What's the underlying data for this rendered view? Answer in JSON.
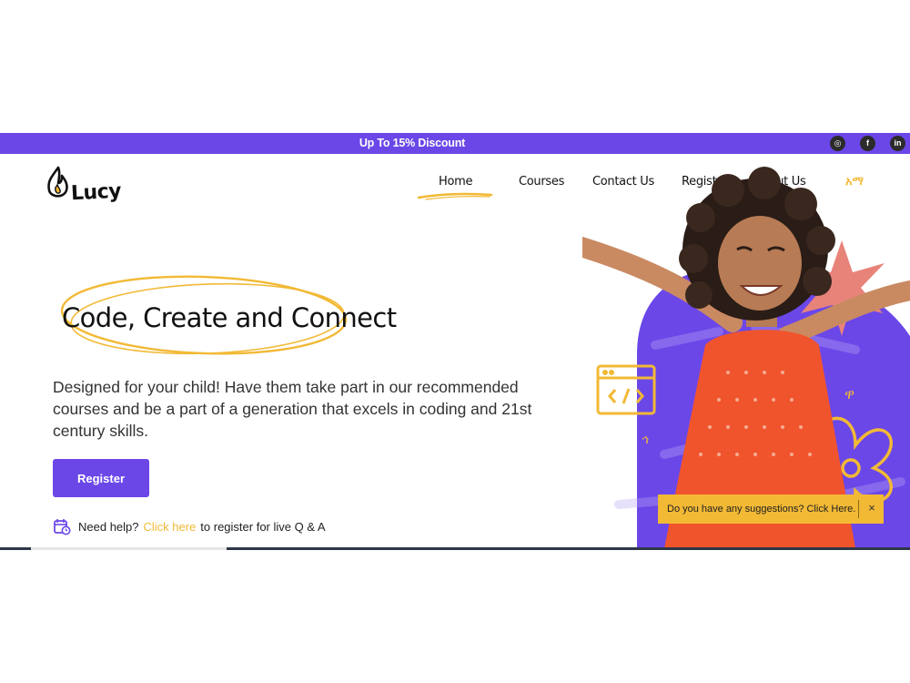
{
  "promo": {
    "text": "Up To 15% Discount"
  },
  "social": [
    {
      "icon": "instagram-icon",
      "glyph": "◎"
    },
    {
      "icon": "facebook-icon",
      "glyph": "f"
    },
    {
      "icon": "linkedin-icon",
      "glyph": "in"
    }
  ],
  "brand": {
    "name": "Lucy"
  },
  "nav": {
    "items": [
      "Home",
      "Courses",
      "Contact Us",
      "Register",
      "About Us"
    ],
    "language": "አማ",
    "active": "Home"
  },
  "hero": {
    "title": "Code, Create and Connect",
    "description": "Designed for your child! Have them take part in our recommended courses and be a part of a generation that excels in coding and 21st century skills.",
    "cta": "Register"
  },
  "help": {
    "prefix": "Need help?",
    "link": "Click here",
    "suffix": "to register for live Q & A"
  },
  "suggestion": {
    "text": "Do you have any suggestions? Click Here.",
    "close": "×"
  },
  "colors": {
    "primary": "#6b47e8",
    "accent": "#f2b935",
    "text": "#222222",
    "star": "#e8837a"
  }
}
